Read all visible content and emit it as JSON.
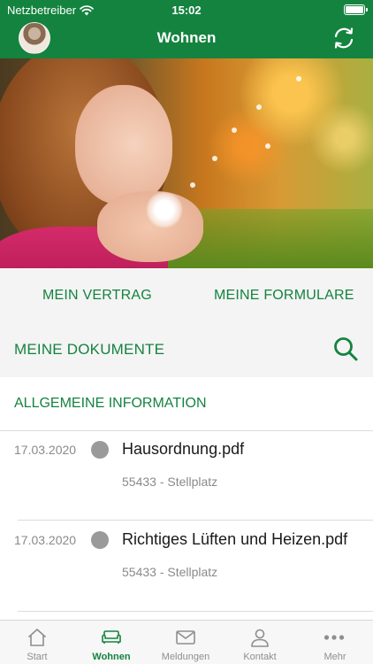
{
  "status_bar": {
    "carrier": "Netzbetreiber",
    "time": "15:02"
  },
  "header": {
    "title": "Wohnen"
  },
  "links": {
    "vertrag": "MEIN VERTRAG",
    "formulare": "MEINE FORMULARE",
    "dokumente": "MEINE DOKUMENTE"
  },
  "section": {
    "title": "ALLGEMEINE INFORMATION"
  },
  "documents": [
    {
      "date": "17.03.2020",
      "name": "Hausordnung.pdf",
      "sub": "55433 - Stellplatz"
    },
    {
      "date": "17.03.2020",
      "name": "Richtiges Lüften und Heizen.pdf",
      "sub": "55433 - Stellplatz"
    }
  ],
  "tabs": [
    {
      "label": "Start",
      "icon": "home-icon"
    },
    {
      "label": "Wohnen",
      "icon": "sofa-icon",
      "active": true
    },
    {
      "label": "Meldungen",
      "icon": "envelope-icon"
    },
    {
      "label": "Kontakt",
      "icon": "person-icon"
    },
    {
      "label": "Mehr",
      "icon": "more-icon"
    }
  ],
  "colors": {
    "brand": "#14833f",
    "tab_inactive": "#8e8e8e",
    "status_dot": "#9a9a9a"
  }
}
